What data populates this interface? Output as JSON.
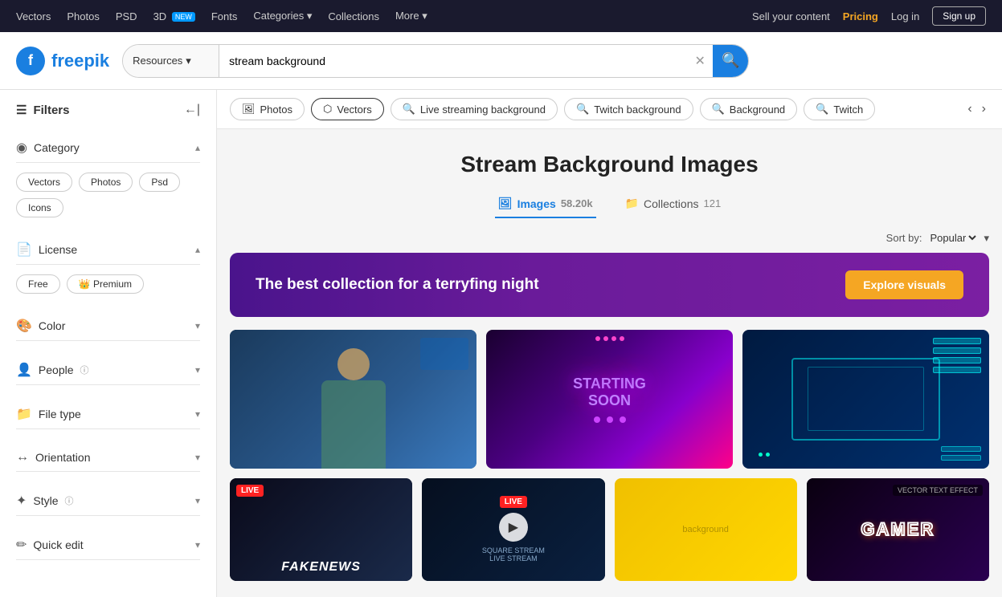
{
  "topNav": {
    "links": [
      "Vectors",
      "Photos",
      "PSD",
      "3D",
      "Fonts",
      "Categories",
      "Collections",
      "More"
    ],
    "3d_badge": "NEW",
    "right_links": [
      "Sell your content",
      "Pricing",
      "Log in"
    ],
    "signup_label": "Sign up"
  },
  "header": {
    "logo_text": "freepik",
    "search_category": "Resources",
    "search_value": "stream background",
    "search_placeholder": "stream background"
  },
  "filterTabs": {
    "tabs": [
      {
        "id": "photos",
        "icon": "🖼",
        "label": "Photos"
      },
      {
        "id": "vectors",
        "icon": "⬡",
        "label": "Vectors"
      },
      {
        "id": "live-streaming",
        "icon": "🔍",
        "label": "Live streaming background"
      },
      {
        "id": "twitch-background",
        "icon": "🔍",
        "label": "Twitch background"
      },
      {
        "id": "background",
        "icon": "🔍",
        "label": "Background"
      },
      {
        "id": "twitch",
        "icon": "🔍",
        "label": "Twitch"
      }
    ]
  },
  "sidebar": {
    "title": "Filters",
    "sections": [
      {
        "id": "category",
        "icon": "◉",
        "label": "Category",
        "expanded": true,
        "tags": [
          "Vectors",
          "Photos",
          "Psd",
          "Icons"
        ]
      },
      {
        "id": "license",
        "icon": "📄",
        "label": "License",
        "expanded": true,
        "tags": [
          "Free",
          "Premium"
        ]
      },
      {
        "id": "color",
        "icon": "🎨",
        "label": "Color",
        "expanded": false
      },
      {
        "id": "people",
        "icon": "👤",
        "label": "People",
        "expanded": false,
        "info": true
      },
      {
        "id": "file-type",
        "icon": "📁",
        "label": "File type",
        "expanded": false
      },
      {
        "id": "orientation",
        "icon": "↔",
        "label": "Orientation",
        "expanded": false
      },
      {
        "id": "style",
        "icon": "✦",
        "label": "Style",
        "expanded": false,
        "info": true
      },
      {
        "id": "quick-edit",
        "icon": "✏",
        "label": "Quick edit",
        "expanded": false
      }
    ]
  },
  "page": {
    "title": "Stream Background Images",
    "tabs": [
      {
        "id": "images",
        "icon": "🖼",
        "label": "Images",
        "count": "58.20k"
      },
      {
        "id": "collections",
        "icon": "📁",
        "label": "Collections",
        "count": "121"
      }
    ],
    "active_tab": "images",
    "sort_label": "Sort by:",
    "sort_value": "Popular"
  },
  "banner": {
    "text": "The best collection for a terryfing night",
    "button": "Explore visuals"
  },
  "cards": [
    {
      "id": 1,
      "style": "card-1",
      "type": "photo",
      "desc": "Streamer waving"
    },
    {
      "id": 2,
      "style": "card-2",
      "type": "starting-soon",
      "desc": "Starting Soon graphic"
    },
    {
      "id": 3,
      "style": "card-3",
      "type": "overlay",
      "desc": "Stream overlay HUD"
    },
    {
      "id": 4,
      "style": "card-4",
      "type": "news",
      "desc": "Fake News live"
    },
    {
      "id": 5,
      "style": "card-5",
      "type": "stream-overlay",
      "desc": "Square stream live"
    },
    {
      "id": 6,
      "style": "card-6",
      "type": "yellow",
      "desc": "Yellow background"
    },
    {
      "id": 7,
      "style": "card-7",
      "type": "gamer",
      "desc": "Gamer vector text effect"
    }
  ],
  "icons": {
    "search": "🔍",
    "chevron_down": "▾",
    "chevron_up": "▴",
    "chevron_left": "‹",
    "chevron_right": "›",
    "filter": "⚙",
    "collapse": "←|",
    "info": "ⓘ",
    "crown": "👑",
    "image": "🖼",
    "folder": "📁"
  }
}
